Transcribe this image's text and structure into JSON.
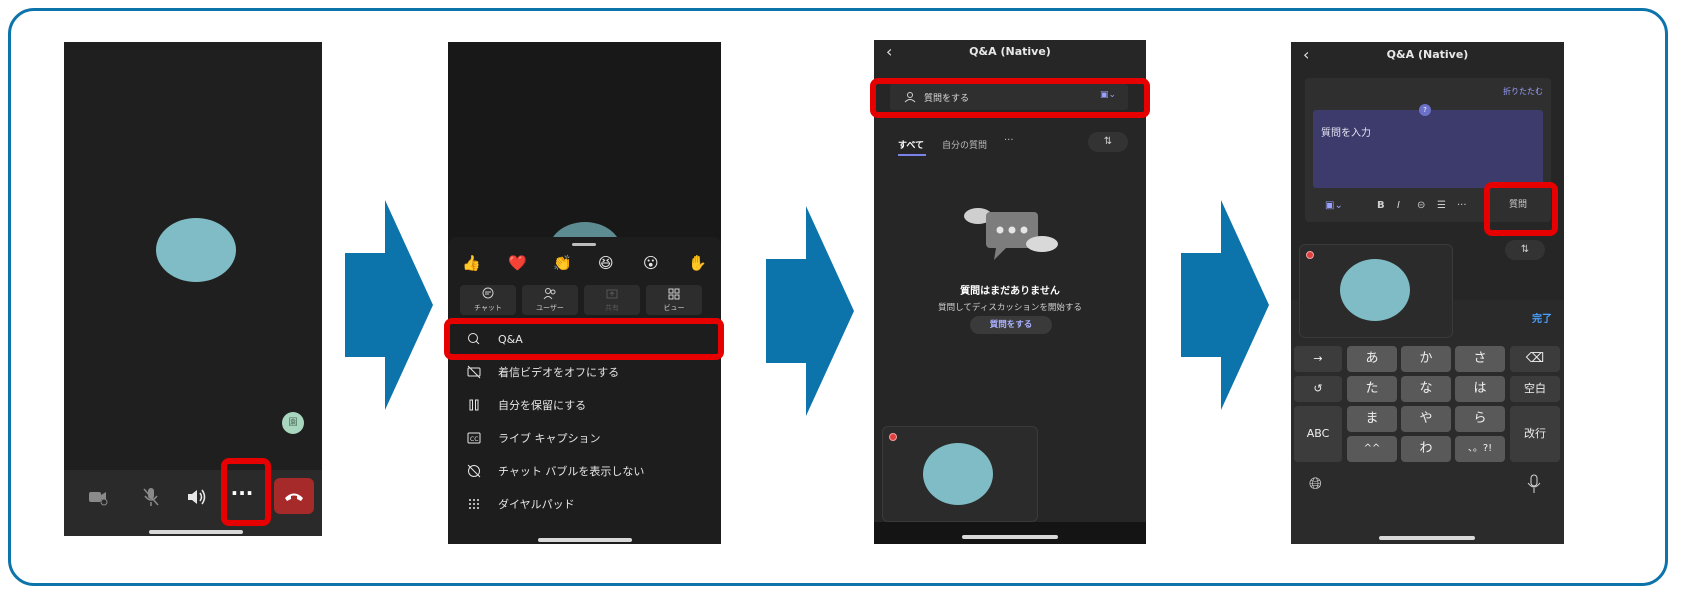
{
  "colors": {
    "accent": "#0d73ab",
    "highlight": "#e60000",
    "brand_purple": "#7b83eb",
    "avatar": "#7fbcc5",
    "end_call": "#a72a2a"
  },
  "step1": {
    "avatar_initial": "園",
    "toolbar_icons": [
      "video-off-icon",
      "mic-off-icon",
      "speaker-icon",
      "more-icon",
      "hang-up-icon"
    ]
  },
  "step2": {
    "reactions": [
      "👍",
      "❤️",
      "👏",
      "😆",
      "😮",
      "✋"
    ],
    "tiles": [
      {
        "icon": "chat-icon",
        "label": "チャット"
      },
      {
        "icon": "people-icon",
        "label": "ユーザー"
      },
      {
        "icon": "share-icon",
        "label": "共有"
      },
      {
        "icon": "view-icon",
        "label": "ビュー"
      }
    ],
    "menu": [
      {
        "icon": "qa-icon",
        "label": "Q&A"
      },
      {
        "icon": "video-off-icon",
        "label": "着信ビデオをオフにする"
      },
      {
        "icon": "hold-icon",
        "label": "自分を保留にする"
      },
      {
        "icon": "captions-icon",
        "label": "ライブ キャプション"
      },
      {
        "icon": "chat-bubble-off-icon",
        "label": "チャット バブルを表示しない"
      },
      {
        "icon": "dialpad-icon",
        "label": "ダイヤルパッド"
      }
    ]
  },
  "step3": {
    "title": "Q&A (Native)",
    "ask_placeholder": "質問をする",
    "tabs": [
      "すべて",
      "自分の質問",
      "···"
    ],
    "empty_title": "質問はまだありません",
    "empty_subtitle": "質問してディスカッションを開始する",
    "ask_button": "質問をする"
  },
  "step4": {
    "title": "Q&A (Native)",
    "collapse": "折りたたむ",
    "input_placeholder": "質問を入力",
    "submit": "質問",
    "done": "完了",
    "format_icons": [
      "B",
      "I",
      "⊝",
      "☰",
      "···"
    ],
    "keys": {
      "r1": [
        "→",
        "あ",
        "か",
        "さ",
        "⌫"
      ],
      "r2": [
        "↺",
        "た",
        "な",
        "は",
        "空白"
      ],
      "r3": [
        "ま",
        "や",
        "ら"
      ],
      "r4": [
        "^^",
        "わ",
        "、。?!"
      ],
      "abc": "ABC",
      "enter": "改行"
    }
  }
}
